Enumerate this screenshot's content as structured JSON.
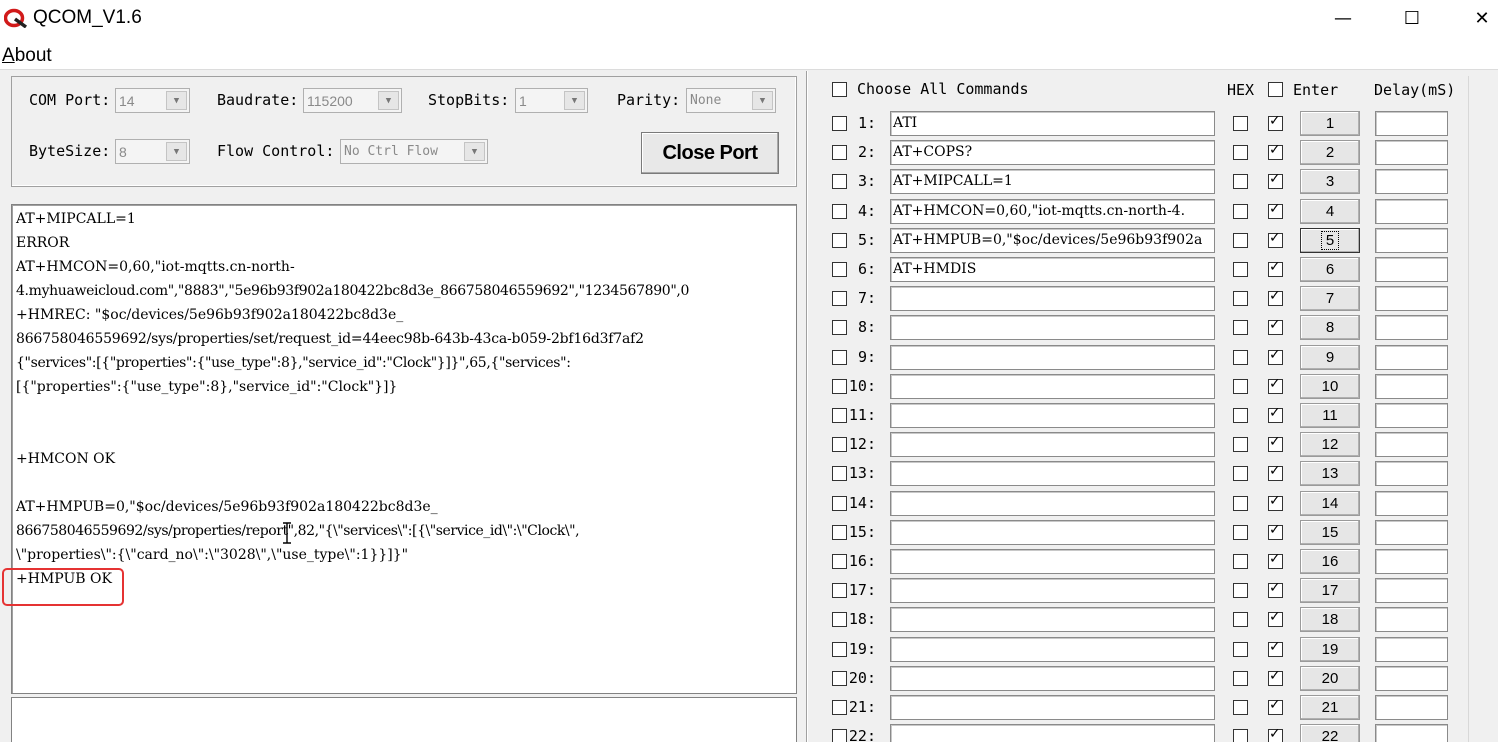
{
  "window": {
    "title": "QCOM_V1.6",
    "minimize_glyph": "—",
    "maximize_glyph": "☐",
    "close_glyph": "✕"
  },
  "menu": {
    "about_first": "A",
    "about_rest": "bout"
  },
  "config": {
    "com_port_label": "COM Port:",
    "com_port_value": "14",
    "baudrate_label": "Baudrate:",
    "baudrate_value": "115200",
    "stopbits_label": "StopBits:",
    "stopbits_value": "1",
    "parity_label": "Parity:",
    "parity_value": "None",
    "bytesize_label": "ByteSize:",
    "bytesize_value": "8",
    "flow_label": "Flow Control:",
    "flow_value": "No Ctrl Flow",
    "close_port_label": "Close Port"
  },
  "console": {
    "lines": [
      "AT+MIPCALL=1",
      "ERROR",
      "AT+HMCON=0,60,\"iot-mqtts.cn-north-",
      "4.myhuaweicloud.com\",\"8883\",\"5e96b93f902a180422bc8d3e_866758046559692\",\"1234567890\",0",
      "+HMREC: \"$oc/devices/5e96b93f902a180422bc8d3e_",
      "866758046559692/sys/properties/set/request_id=44eec98b-643b-43ca-b059-2bf16d3f7af2",
      "{\"services\":[{\"properties\":{\"use_type\":8},\"service_id\":\"Clock\"}]}\",65,{\"services\":",
      "[{\"properties\":{\"use_type\":8},\"service_id\":\"Clock\"}]}",
      "+HMCON OK",
      "AT+HMPUB=0,\"$oc/devices/5e96b93f902a180422bc8d3e_",
      "866758046559692/sys/properties/report\",82,\"{\\\"services\\\":[{\\\"service_id\\\":\\\"Clock\\\",",
      "\\\"properties\\\":{\\\"card_no\\\":\\\"3028\\\",\\\"use_type\\\":1}}]}\"",
      "+HMPUB OK"
    ]
  },
  "commands_header": {
    "choose_all_label": "Choose All Commands",
    "hex_label": "HEX",
    "enter_label": "Enter",
    "delay_label": "Delay(mS)"
  },
  "commands": [
    {
      "num": "1:",
      "text": "ATI",
      "btn": "1"
    },
    {
      "num": "2:",
      "text": "AT+COPS?",
      "btn": "2"
    },
    {
      "num": "3:",
      "text": "AT+MIPCALL=1",
      "btn": "3"
    },
    {
      "num": "4:",
      "text": "AT+HMCON=0,60,\"iot-mqtts.cn-north-4.",
      "btn": "4"
    },
    {
      "num": "5:",
      "text": "AT+HMPUB=0,\"$oc/devices/5e96b93f902a",
      "btn": "5"
    },
    {
      "num": "6:",
      "text": "AT+HMDIS",
      "btn": "6"
    },
    {
      "num": "7:",
      "text": "",
      "btn": "7"
    },
    {
      "num": "8:",
      "text": "",
      "btn": "8"
    },
    {
      "num": "9:",
      "text": "",
      "btn": "9"
    },
    {
      "num": "10:",
      "text": "",
      "btn": "10"
    },
    {
      "num": "11:",
      "text": "",
      "btn": "11"
    },
    {
      "num": "12:",
      "text": "",
      "btn": "12"
    },
    {
      "num": "13:",
      "text": "",
      "btn": "13"
    },
    {
      "num": "14:",
      "text": "",
      "btn": "14"
    },
    {
      "num": "15:",
      "text": "",
      "btn": "15"
    },
    {
      "num": "16:",
      "text": "",
      "btn": "16"
    },
    {
      "num": "17:",
      "text": "",
      "btn": "17"
    },
    {
      "num": "18:",
      "text": "",
      "btn": "18"
    },
    {
      "num": "19:",
      "text": "",
      "btn": "19"
    },
    {
      "num": "20:",
      "text": "",
      "btn": "20"
    },
    {
      "num": "21:",
      "text": "",
      "btn": "21"
    },
    {
      "num": "22:",
      "text": "",
      "btn": "22"
    }
  ],
  "colors": {
    "highlight": "#e53333",
    "window_bg": "#f0f0f0",
    "logo_red": "#d11a1a"
  }
}
